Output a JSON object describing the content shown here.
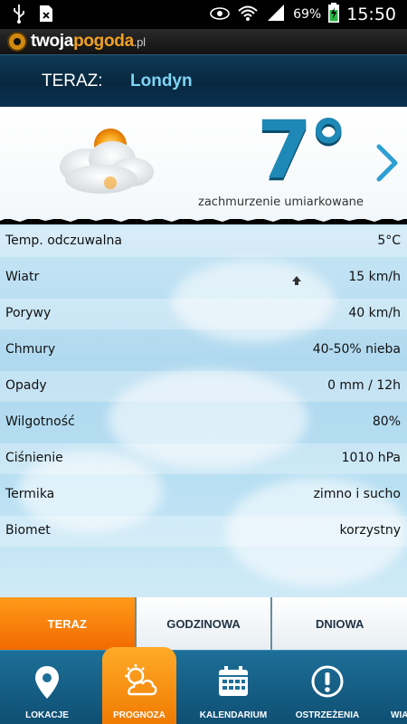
{
  "status_bar": {
    "battery_percent": "69%",
    "time": "15:50",
    "icons": [
      "usb-icon",
      "sim-icon",
      "eye-icon",
      "wifi-icon",
      "signal-icon",
      "battery-charging-icon"
    ]
  },
  "app": {
    "logo_part1": "twoja",
    "logo_part2": "pogoda",
    "logo_tld": ".pl"
  },
  "header": {
    "now_label": "TERAZ:",
    "city": "Londyn"
  },
  "current": {
    "temperature": "7°",
    "condition": "zachmurzenie umiarkowane",
    "icon": "partly-cloudy-icon"
  },
  "details": [
    {
      "label": "Temp. odczuwalna",
      "value": "5°C"
    },
    {
      "label": "Wiatr",
      "value": "15 km/h"
    },
    {
      "label": "Porywy",
      "value": "40 km/h"
    },
    {
      "label": "Chmury",
      "value": "40-50% nieba"
    },
    {
      "label": "Opady",
      "value": "0 mm / 12h"
    },
    {
      "label": "Wilgotność",
      "value": "80%"
    },
    {
      "label": "Ciśnienie",
      "value": "1010 hPa"
    },
    {
      "label": "Termika",
      "value": "zimno i sucho"
    },
    {
      "label": "Biomet",
      "value": "korzystny"
    }
  ],
  "tabs": [
    {
      "label": "TERAZ",
      "active": true
    },
    {
      "label": "GODZINOWA",
      "active": false
    },
    {
      "label": "DNIOWA",
      "active": false
    }
  ],
  "bottom_nav": [
    {
      "label": "LOKACJE",
      "icon": "location-pin-icon"
    },
    {
      "label": "PROGNOZA",
      "icon": "sun-cloud-icon",
      "active": true
    },
    {
      "label": "KALENDARIUM",
      "icon": "calendar-icon"
    },
    {
      "label": "OSTRZEŻENIA",
      "icon": "warning-icon"
    },
    {
      "label": "WIA",
      "icon": "wind-icon"
    }
  ],
  "colors": {
    "accent_orange": "#f26a00",
    "temp_blue": "#1e88b6",
    "city_blue": "#7fd3f5",
    "header_dark": "#08283f"
  }
}
